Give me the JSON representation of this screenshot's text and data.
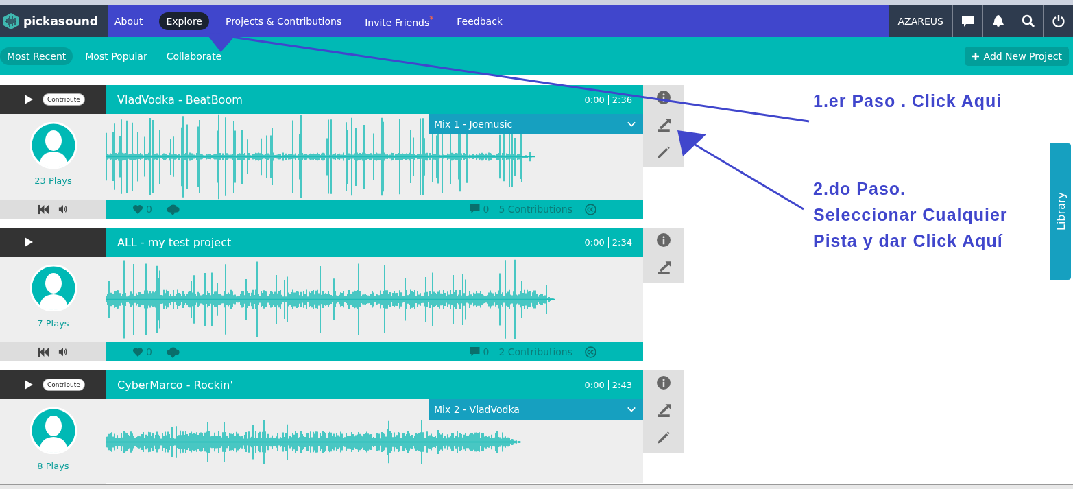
{
  "app": {
    "logo_text": "pickasound"
  },
  "nav": [
    {
      "label": "About",
      "selected": false
    },
    {
      "label": "Explore",
      "selected": true
    },
    {
      "label": "Projects & Contributions",
      "selected": false
    },
    {
      "label": "Invite Friends$^{*}$",
      "selected": false
    },
    {
      "label": "Feedback",
      "selected": false
    }
  ],
  "user": {
    "name": "AZAREUS"
  },
  "subnav": [
    {
      "label": "Most Recent",
      "selected": true
    },
    {
      "label": "Most Popular",
      "selected": false
    },
    {
      "label": "Collaborate",
      "selected": false
    }
  ],
  "add_button": "Add New Project",
  "projects": [
    {
      "title": "VladVodka - BeatBoom",
      "contribute": "Contribute",
      "current": "0:00",
      "duration": "2:36",
      "mix": "Mix 1 - Joemusic",
      "plays": "23 Plays",
      "editable": true,
      "footer": {
        "likes": "0",
        "comments": "0",
        "contributions": "5 Contributions"
      }
    },
    {
      "title": "ALL - my test project",
      "current": "0:00",
      "duration": "2:34",
      "plays": "7 Plays",
      "editable": false,
      "footer": {
        "likes": "0",
        "comments": "0",
        "contributions": "2 Contributions"
      }
    },
    {
      "title": "CyberMarco - Rockin'",
      "contribute": "Contribute",
      "current": "0:00",
      "duration": "2:43",
      "mix": "Mix 2 - VladVodka",
      "plays": "8 Plays",
      "editable": true
    }
  ],
  "library_tab": "Library",
  "annotations": [
    {
      "lines": [
        "1.er Paso . Click Aqui"
      ]
    },
    {
      "lines": [
        "2.do Paso.",
        "Seleccionar Cualquier",
        "Pista y dar Click Aquí"
      ]
    }
  ]
}
